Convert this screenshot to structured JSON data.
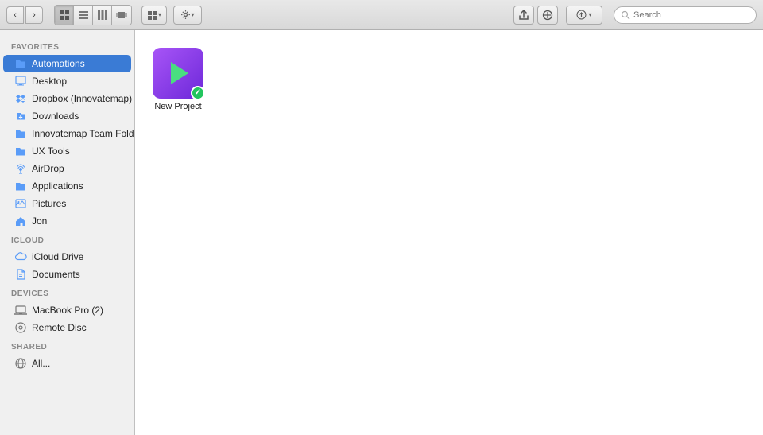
{
  "toolbar": {
    "back_label": "‹",
    "forward_label": "›",
    "view_icon": "⊞",
    "view_list": "≡",
    "view_column": "|||",
    "view_coverflow": "⊡",
    "arrange_label": "⊞▾",
    "action_label": "⚙▾",
    "share_label": "↑",
    "tag_label": "◯",
    "search_placeholder": "Search"
  },
  "sidebar": {
    "favorites_label": "Favorites",
    "icloud_label": "iCloud",
    "devices_label": "Devices",
    "shared_label": "Shared",
    "favorites": [
      {
        "id": "automations",
        "label": "Automations",
        "icon": "📁",
        "active": true
      },
      {
        "id": "desktop",
        "label": "Desktop",
        "icon": "🖥"
      },
      {
        "id": "dropbox",
        "label": "Dropbox (Innovatemap)",
        "icon": "📦"
      },
      {
        "id": "downloads",
        "label": "Downloads",
        "icon": "📥"
      },
      {
        "id": "innovatemap-team",
        "label": "Innovatemap Team Folder",
        "icon": "📁"
      },
      {
        "id": "ux-tools",
        "label": "UX Tools",
        "icon": "📁"
      },
      {
        "id": "airdrop",
        "label": "AirDrop",
        "icon": "📡"
      },
      {
        "id": "applications",
        "label": "Applications",
        "icon": "📁"
      },
      {
        "id": "pictures",
        "label": "Pictures",
        "icon": "🖼"
      },
      {
        "id": "jon",
        "label": "Jon",
        "icon": "🏠"
      }
    ],
    "icloud": [
      {
        "id": "icloud-drive",
        "label": "iCloud Drive",
        "icon": "☁"
      },
      {
        "id": "documents",
        "label": "Documents",
        "icon": "📄"
      }
    ],
    "devices": [
      {
        "id": "macbook-pro",
        "label": "MacBook Pro (2)",
        "icon": "💻"
      },
      {
        "id": "remote-disc",
        "label": "Remote Disc",
        "icon": "💿"
      }
    ],
    "shared": [
      {
        "id": "all",
        "label": "All...",
        "icon": "🌐"
      }
    ]
  },
  "content": {
    "files": [
      {
        "id": "new-project",
        "name": "New Project",
        "has_badge": true
      }
    ]
  }
}
